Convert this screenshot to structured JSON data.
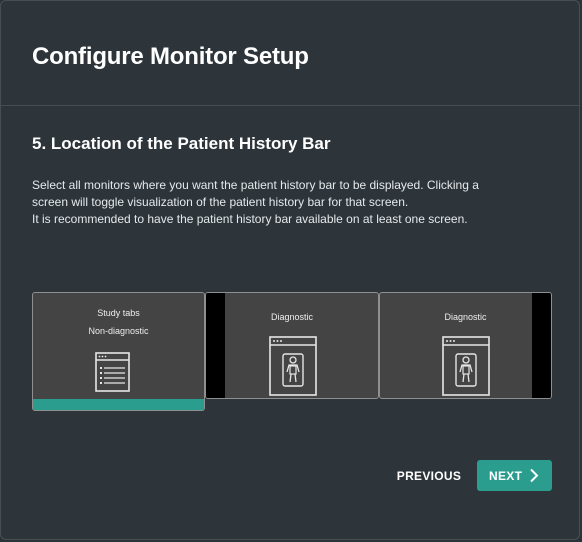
{
  "dialog": {
    "title": "Configure Monitor Setup"
  },
  "section": {
    "title": "5. Location of the Patient History Bar",
    "description": [
      "Select all monitors where you want the patient history bar to be displayed. Clicking a",
      "screen will toggle visualization of the patient history bar for that screen.",
      "It is recommended to have the patient history bar available on at least one screen."
    ]
  },
  "monitors": [
    {
      "label": "Study tabs",
      "sublabel": "Non-diagnostic",
      "icon": "study-tabs-window-icon",
      "history_bar_enabled": true
    },
    {
      "label": "Diagnostic",
      "icon": "xray-viewer-icon",
      "history_bar_enabled": false
    },
    {
      "label": "Diagnostic",
      "icon": "xray-viewer-icon",
      "history_bar_enabled": false
    }
  ],
  "buttons": {
    "previous": "PREVIOUS",
    "next": "NEXT"
  },
  "colors": {
    "accent": "#2a9d8f",
    "background": "#2d353b",
    "monitor": "#444444"
  }
}
